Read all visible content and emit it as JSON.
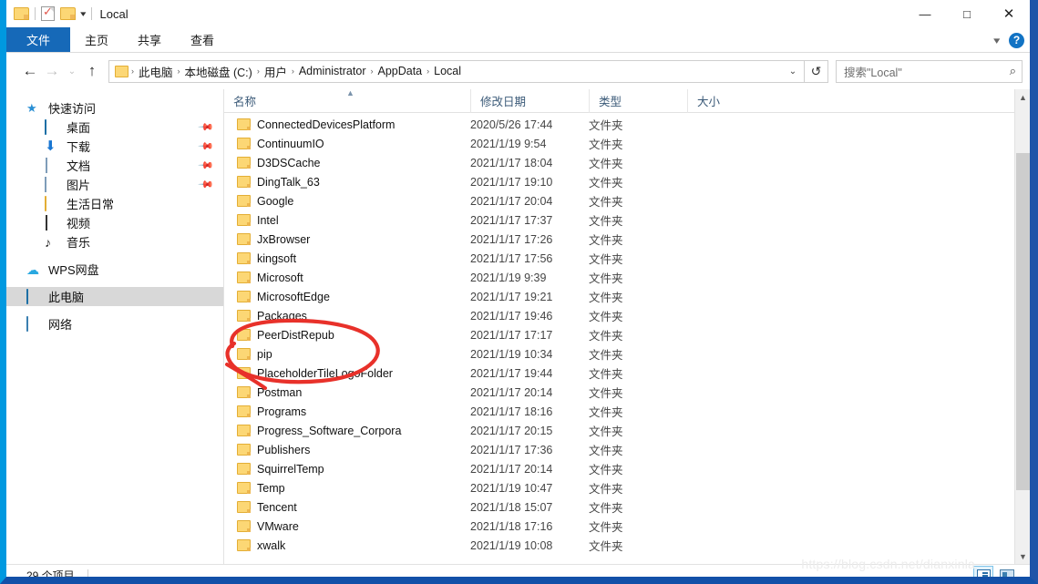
{
  "window": {
    "title": "Local",
    "quick_access_icons": [
      "folder-icon",
      "checkbox-properties-icon",
      "folder-icon",
      "chevron-down-icon"
    ],
    "controls": {
      "minimize": "—",
      "maximize": "☐",
      "close": "✕"
    }
  },
  "ribbon": {
    "tabs": [
      {
        "label": "文件",
        "active": true
      },
      {
        "label": "主页",
        "active": false
      },
      {
        "label": "共享",
        "active": false
      },
      {
        "label": "查看",
        "active": false
      }
    ],
    "collapse_icon": "chevron-down-icon",
    "help_label": "?"
  },
  "addressbar": {
    "back_icon": "←",
    "forward_icon": "→",
    "recent_icon": "⌄",
    "up_icon": "↑",
    "breadcrumbs": [
      "此电脑",
      "本地磁盘 (C:)",
      "用户",
      "Administrator",
      "AppData",
      "Local"
    ],
    "separator": "›",
    "dropdown_icon": "⌄",
    "refresh_icon": "↺",
    "search_placeholder": "搜索\"Local\"",
    "search_icon": "⌕"
  },
  "sidebar": {
    "items": [
      {
        "label": "快速访问",
        "icon": "star-icon",
        "indent": false,
        "pinned": false,
        "selected": false
      },
      {
        "label": "桌面",
        "icon": "monitor-icon",
        "indent": true,
        "pinned": true,
        "selected": false
      },
      {
        "label": "下载",
        "icon": "download-icon",
        "indent": true,
        "pinned": true,
        "selected": false
      },
      {
        "label": "文档",
        "icon": "document-icon",
        "indent": true,
        "pinned": true,
        "selected": false
      },
      {
        "label": "图片",
        "icon": "picture-icon",
        "indent": true,
        "pinned": true,
        "selected": false
      },
      {
        "label": "生活日常",
        "icon": "folder-icon",
        "indent": true,
        "pinned": false,
        "selected": false
      },
      {
        "label": "视频",
        "icon": "video-icon",
        "indent": true,
        "pinned": false,
        "selected": false
      },
      {
        "label": "音乐",
        "icon": "music-icon",
        "indent": true,
        "pinned": false,
        "selected": false
      },
      {
        "label": "WPS网盘",
        "icon": "cloud-icon",
        "indent": false,
        "pinned": false,
        "selected": false
      },
      {
        "label": "此电脑",
        "icon": "monitor-icon",
        "indent": false,
        "pinned": false,
        "selected": true
      },
      {
        "label": "网络",
        "icon": "network-icon",
        "indent": false,
        "pinned": false,
        "selected": false
      }
    ]
  },
  "filelist": {
    "columns": [
      "名称",
      "修改日期",
      "类型",
      "大小"
    ],
    "sort_column": "名称",
    "sort_direction": "asc",
    "rows": [
      {
        "name": "ConnectedDevicesPlatform",
        "date": "2020/5/26 17:44",
        "type": "文件夹",
        "size": ""
      },
      {
        "name": "ContinuumIO",
        "date": "2021/1/19 9:54",
        "type": "文件夹",
        "size": ""
      },
      {
        "name": "D3DSCache",
        "date": "2021/1/17 18:04",
        "type": "文件夹",
        "size": ""
      },
      {
        "name": "DingTalk_63",
        "date": "2021/1/17 19:10",
        "type": "文件夹",
        "size": ""
      },
      {
        "name": "Google",
        "date": "2021/1/17 20:04",
        "type": "文件夹",
        "size": ""
      },
      {
        "name": "Intel",
        "date": "2021/1/17 17:37",
        "type": "文件夹",
        "size": ""
      },
      {
        "name": "JxBrowser",
        "date": "2021/1/17 17:26",
        "type": "文件夹",
        "size": ""
      },
      {
        "name": "kingsoft",
        "date": "2021/1/17 17:56",
        "type": "文件夹",
        "size": ""
      },
      {
        "name": "Microsoft",
        "date": "2021/1/19 9:39",
        "type": "文件夹",
        "size": ""
      },
      {
        "name": "MicrosoftEdge",
        "date": "2021/1/17 19:21",
        "type": "文件夹",
        "size": ""
      },
      {
        "name": "Packages",
        "date": "2021/1/17 19:46",
        "type": "文件夹",
        "size": ""
      },
      {
        "name": "PeerDistRepub",
        "date": "2021/1/17 17:17",
        "type": "文件夹",
        "size": ""
      },
      {
        "name": "pip",
        "date": "2021/1/19 10:34",
        "type": "文件夹",
        "size": ""
      },
      {
        "name": "PlaceholderTileLogoFolder",
        "date": "2021/1/17 19:44",
        "type": "文件夹",
        "size": ""
      },
      {
        "name": "Postman",
        "date": "2021/1/17 20:14",
        "type": "文件夹",
        "size": ""
      },
      {
        "name": "Programs",
        "date": "2021/1/17 18:16",
        "type": "文件夹",
        "size": ""
      },
      {
        "name": "Progress_Software_Corpora",
        "date": "2021/1/17 20:15",
        "type": "文件夹",
        "size": ""
      },
      {
        "name": "Publishers",
        "date": "2021/1/17 17:36",
        "type": "文件夹",
        "size": ""
      },
      {
        "name": "SquirrelTemp",
        "date": "2021/1/17 20:14",
        "type": "文件夹",
        "size": ""
      },
      {
        "name": "Temp",
        "date": "2021/1/19 10:47",
        "type": "文件夹",
        "size": ""
      },
      {
        "name": "Tencent",
        "date": "2021/1/18 15:07",
        "type": "文件夹",
        "size": ""
      },
      {
        "name": "VMware",
        "date": "2021/1/18 17:16",
        "type": "文件夹",
        "size": ""
      },
      {
        "name": "xwalk",
        "date": "2021/1/19 10:08",
        "type": "文件夹",
        "size": ""
      }
    ]
  },
  "statusbar": {
    "item_count": "29 个项目",
    "view_buttons": [
      {
        "name": "details-view",
        "active": true
      },
      {
        "name": "large-icons-view",
        "active": false
      }
    ]
  },
  "watermark": {
    "text": "https://blog.csdn.net/dianxinla"
  },
  "annotation": {
    "type": "hand-drawn-ellipse",
    "color": "#e8312a"
  },
  "colors": {
    "accent": "#1669b8",
    "selection": "#d8d8d8",
    "folder": "#fcd775",
    "annotation_red": "#e8312a",
    "window_border": "#1f54a8"
  }
}
